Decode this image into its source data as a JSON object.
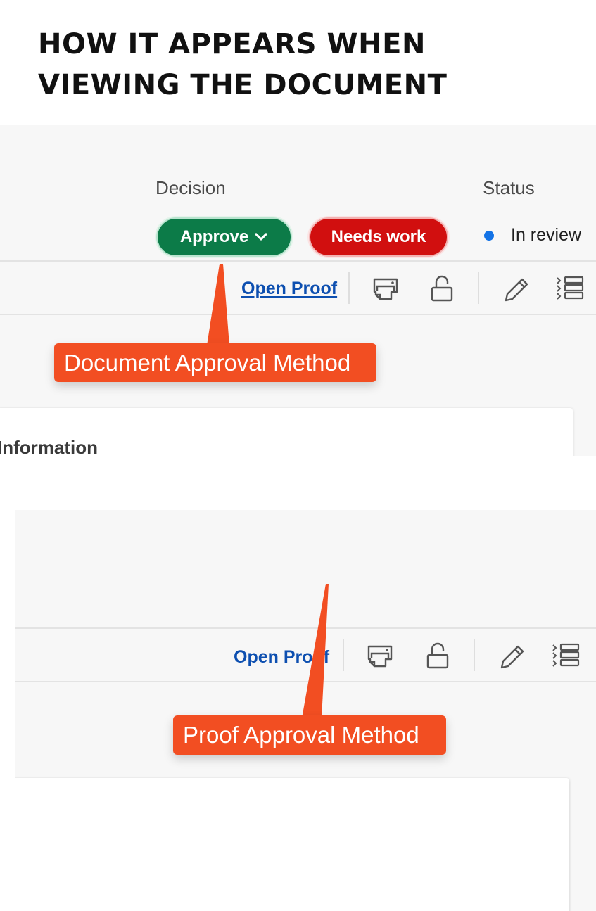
{
  "heading": {
    "line1": "How it appears when",
    "line2": "viewing the document"
  },
  "panel1": {
    "decision_label": "Decision",
    "status_label": "Status",
    "approve_button": "Approve",
    "needs_work_button": "Needs work",
    "status_value": "In review",
    "open_proof_link": "Open Proof",
    "callout": "Document Approval Method",
    "card_title": "Information"
  },
  "panel2": {
    "open_proof_link": "Open Proof",
    "callout": "Proof Approval Method"
  },
  "colors": {
    "approve": "#0c7b48",
    "needs_work": "#d10f0f",
    "status_dot": "#1473e6",
    "link": "#0d4fb0",
    "callout": "#f24e22"
  },
  "icons": [
    "chevron-down-icon",
    "print-icon",
    "unlock-icon",
    "pencil-icon",
    "list-icon"
  ]
}
